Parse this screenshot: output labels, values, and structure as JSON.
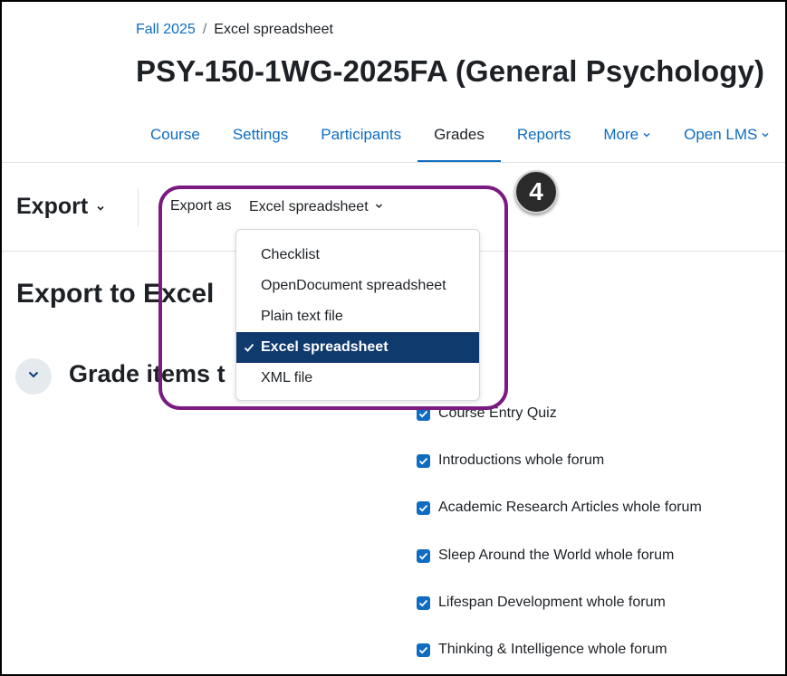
{
  "breadcrumb": {
    "parent": "Fall 2025",
    "separator": "/",
    "current": "Excel spreadsheet"
  },
  "page_title": "PSY-150-1WG-2025FA (General Psychology)",
  "course_nav": [
    {
      "label": "Course",
      "active": false
    },
    {
      "label": "Settings",
      "active": false
    },
    {
      "label": "Participants",
      "active": false
    },
    {
      "label": "Grades",
      "active": true
    },
    {
      "label": "Reports",
      "active": false
    },
    {
      "label": "More",
      "has_menu": true
    },
    {
      "label": "Open LMS",
      "has_menu": true
    }
  ],
  "tertiary_nav": {
    "label": "Export"
  },
  "export_as": {
    "label": "Export as",
    "selected": "Excel spreadsheet",
    "options": [
      {
        "label": "Checklist",
        "selected": false
      },
      {
        "label": "OpenDocument spreadsheet",
        "selected": false
      },
      {
        "label": "Plain text file",
        "selected": false
      },
      {
        "label": "Excel spreadsheet",
        "selected": true
      },
      {
        "label": "XML file",
        "selected": false
      }
    ]
  },
  "annotation": {
    "step_number": "4",
    "highlight_color": "#7b1a80"
  },
  "main": {
    "section_title": "Export to Excel",
    "subsection_title": "Grade items t",
    "grade_items": [
      {
        "label": "Course Entry Quiz",
        "checked": true
      },
      {
        "label": "Introductions whole forum",
        "checked": true
      },
      {
        "label": "Academic Research Articles whole forum",
        "checked": true
      },
      {
        "label": "Sleep Around the World whole forum",
        "checked": true
      },
      {
        "label": "Lifespan Development whole forum",
        "checked": true
      },
      {
        "label": "Thinking & Intelligence whole forum",
        "checked": true
      }
    ]
  },
  "colors": {
    "link": "#0f6cbf",
    "selected_bg": "#0f3a6e",
    "text": "#1d2125"
  }
}
